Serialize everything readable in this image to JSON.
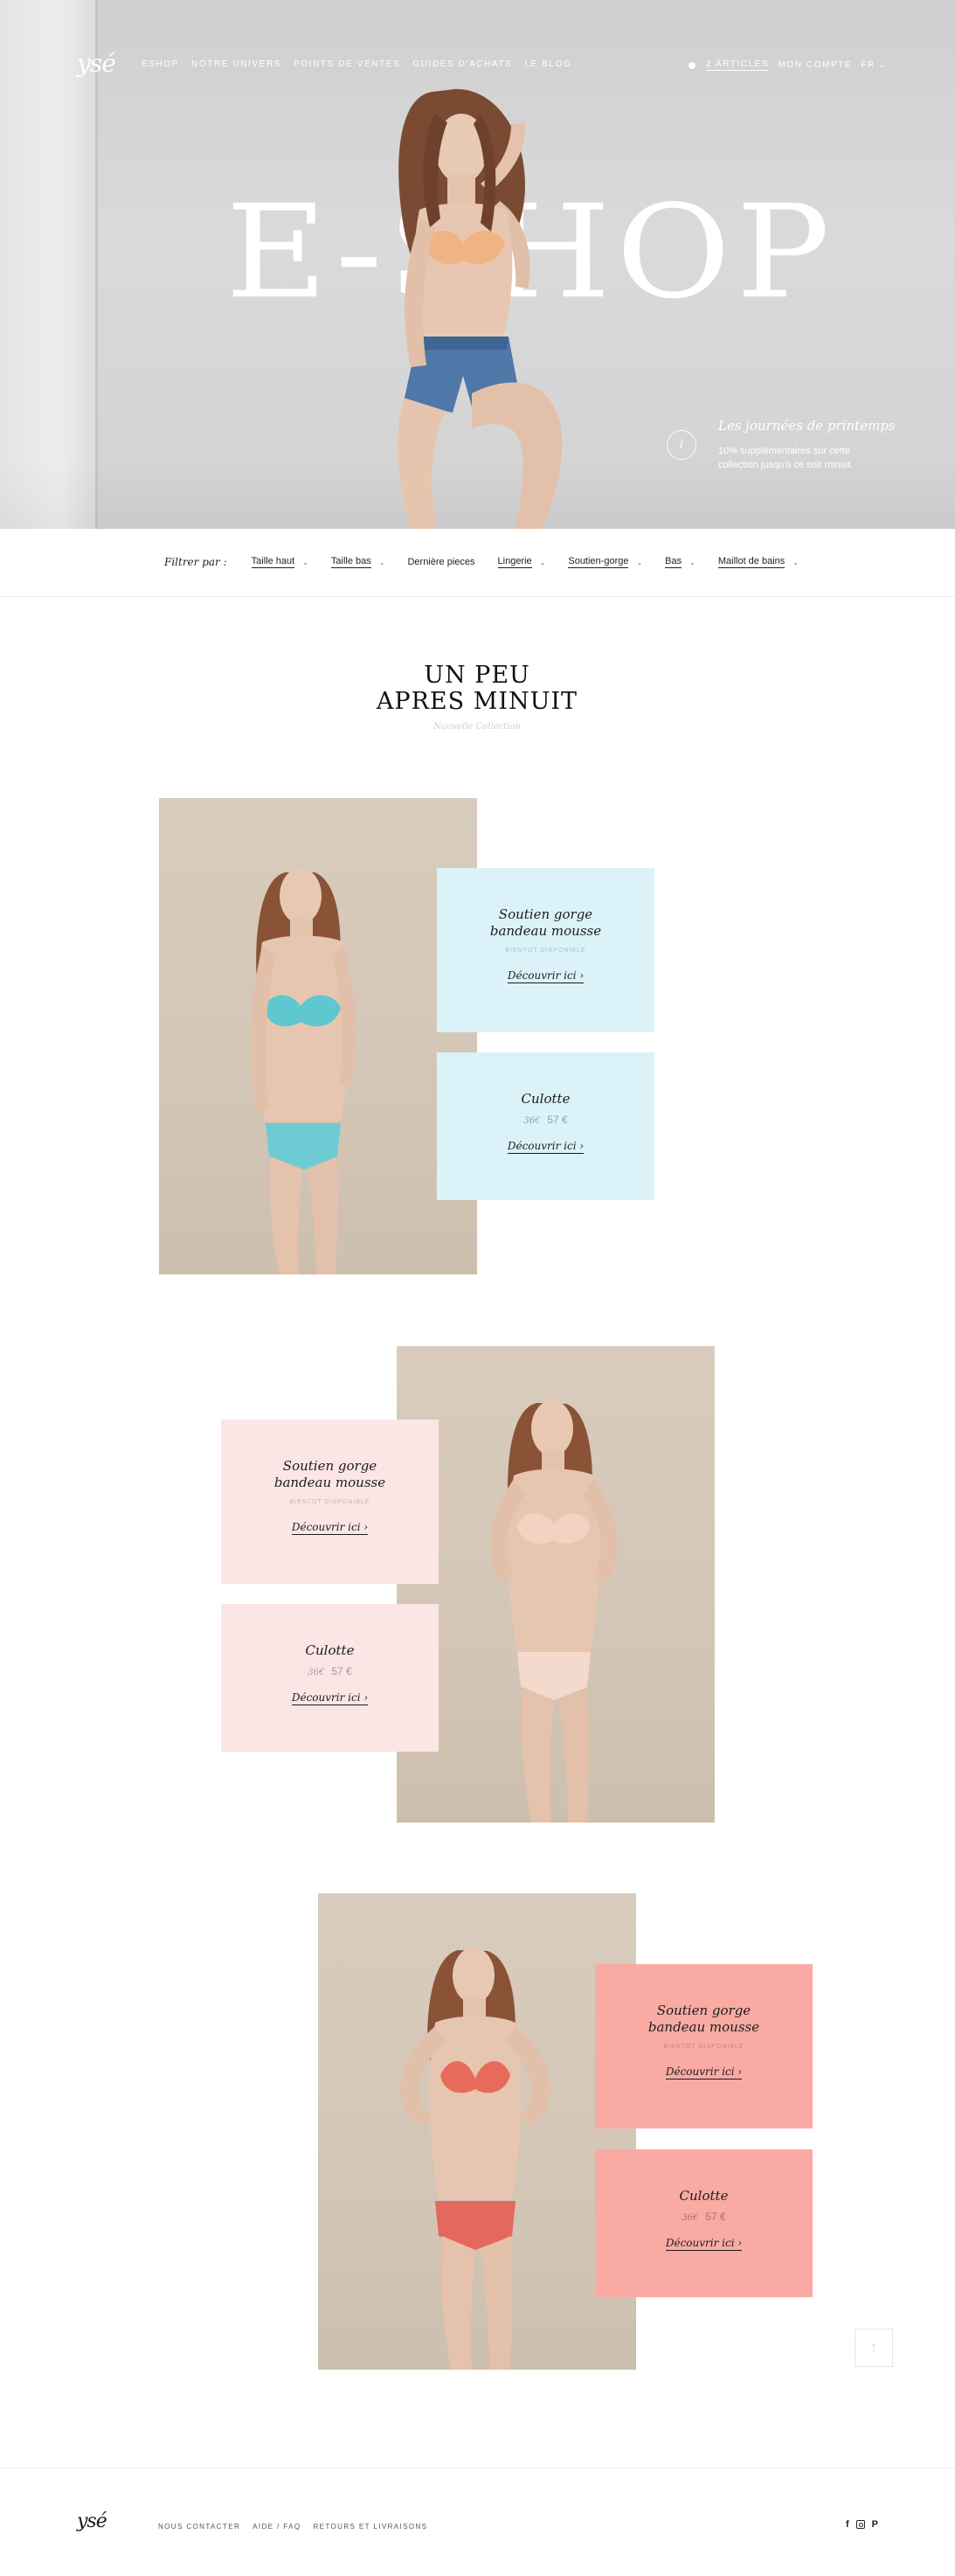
{
  "brand": {
    "logo": "ysé"
  },
  "nav": {
    "links": [
      "ESHOP",
      "NOTRE UNIVERS",
      "POINTS DE VENTES",
      "GUIDES D'ACHATS",
      "LE BLOG"
    ],
    "cart_label": "2 ARTICLES",
    "account_label": "MON COMPTE",
    "language": "FR"
  },
  "hero": {
    "title": "E-SHOP",
    "promo": {
      "icon_label": "i",
      "title": "Les journées de printemps",
      "text": "10% supplémentaires sur cette collection jusqu'à ce soir minuit."
    }
  },
  "filters": {
    "label": "Filtrer par :",
    "items": [
      {
        "label": "Taille haut",
        "has_dropdown": true
      },
      {
        "label": "Taille bas",
        "has_dropdown": true
      },
      {
        "label": "Dernière pieces",
        "has_dropdown": false
      },
      {
        "label": "Lingerie",
        "has_dropdown": true
      },
      {
        "label": "Soutien-gorge",
        "has_dropdown": true
      },
      {
        "label": "Bas",
        "has_dropdown": true
      },
      {
        "label": "Maillot de bains",
        "has_dropdown": true
      }
    ]
  },
  "collection": {
    "title_line1": "UN PEU",
    "title_line2": "APRES MINUIT",
    "subtitle": "Nouvelle Collection"
  },
  "products": [
    {
      "color": "#dbf3f8",
      "bra": {
        "name_line1": "Soutien gorge",
        "name_line2": "bandeau mousse",
        "availability": "BIENTOT DISPONIBLE",
        "cta": "Découvrir ici ›"
      },
      "panty": {
        "name": "Culotte",
        "old_price": "36€",
        "price": "57 €",
        "cta": "Découvrir ici ›"
      }
    },
    {
      "color": "#fbe6e5",
      "bra": {
        "name_line1": "Soutien gorge",
        "name_line2": "bandeau mousse",
        "availability": "BIENTOT DISPONIBLE",
        "cta": "Découvrir ici ›"
      },
      "panty": {
        "name": "Culotte",
        "old_price": "36€",
        "price": "57 €",
        "cta": "Découvrir ici ›"
      }
    },
    {
      "color": "#f9aba3",
      "bra": {
        "name_line1": "Soutien gorge",
        "name_line2": "bandeau mousse",
        "availability": "BIENTOT DISPONIBLE",
        "cta": "Découvrir ici ›"
      },
      "panty": {
        "name": "Culotte",
        "old_price": "36€",
        "price": "57 €",
        "cta": "Découvrir ici ›"
      }
    }
  ],
  "scroll_top": {
    "icon": "arrow-up-icon",
    "glyph": "↑"
  },
  "footer": {
    "logo": "ysé",
    "links": [
      "NOUS CONTACTER",
      "AIDE / FAQ",
      "RETOURS ET LIVRAISONS"
    ],
    "social": [
      "facebook-icon",
      "instagram-icon",
      "pinterest-icon"
    ],
    "social_glyphs": {
      "facebook": "f",
      "pinterest": "P"
    }
  }
}
